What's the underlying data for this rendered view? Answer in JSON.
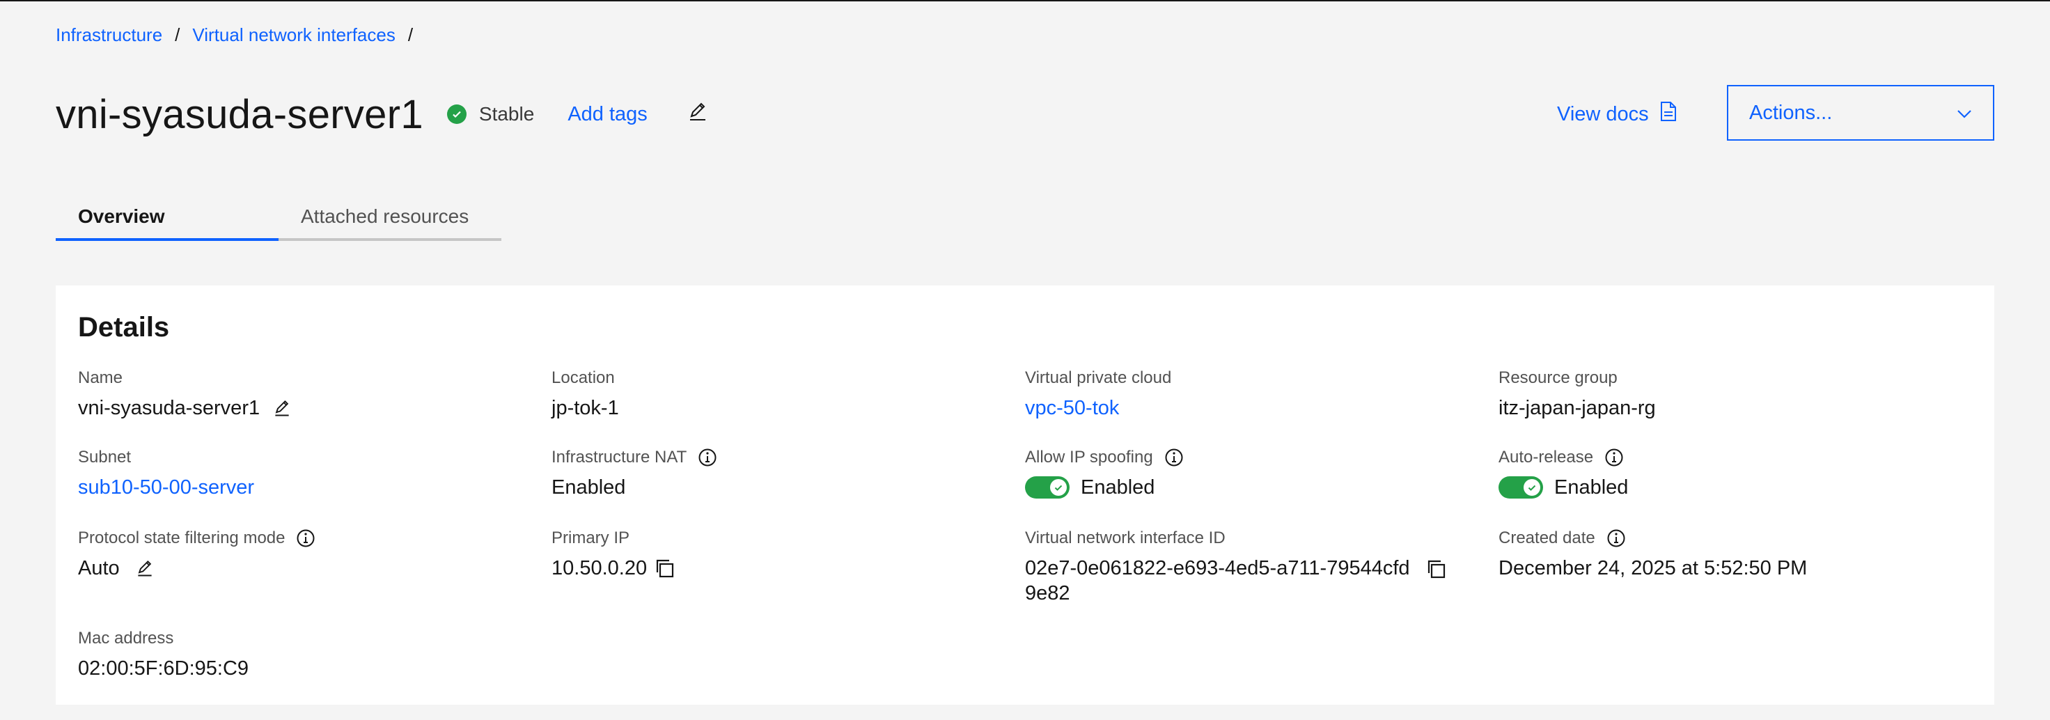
{
  "breadcrumb": {
    "items": [
      "Infrastructure",
      "Virtual network interfaces"
    ],
    "separator": "/"
  },
  "header": {
    "title": "vni-syasuda-server1",
    "status": "Stable",
    "add_tags": "Add tags",
    "view_docs": "View docs",
    "actions": "Actions..."
  },
  "tabs": [
    {
      "label": "Overview",
      "active": true
    },
    {
      "label": "Attached resources",
      "active": false
    }
  ],
  "details": {
    "title": "Details",
    "name": {
      "label": "Name",
      "value": "vni-syasuda-server1"
    },
    "location": {
      "label": "Location",
      "value": "jp-tok-1"
    },
    "vpc": {
      "label": "Virtual private cloud",
      "value": "vpc-50-tok"
    },
    "resource_group": {
      "label": "Resource group",
      "value": "itz-japan-japan-rg"
    },
    "subnet": {
      "label": "Subnet",
      "value": "sub10-50-00-server"
    },
    "infra_nat": {
      "label": "Infrastructure NAT",
      "value": "Enabled"
    },
    "ip_spoofing": {
      "label": "Allow IP spoofing",
      "value": "Enabled"
    },
    "auto_release": {
      "label": "Auto-release",
      "value": "Enabled"
    },
    "protocol_filter": {
      "label": "Protocol state filtering mode",
      "value": "Auto"
    },
    "primary_ip": {
      "label": "Primary IP",
      "value": "10.50.0.20"
    },
    "vni_id": {
      "label": "Virtual network interface ID",
      "line1": "02e7-0e061822-e693-4ed5-a711-79544cfd",
      "line2": "9e82"
    },
    "created": {
      "label": "Created date",
      "value": "December 24, 2025 at 5:52:50 PM"
    },
    "mac": {
      "label": "Mac address",
      "value": "02:00:5F:6D:95:C9"
    }
  },
  "colors": {
    "link": "#0f62fe",
    "success": "#24a148",
    "background": "#f4f4f4"
  }
}
